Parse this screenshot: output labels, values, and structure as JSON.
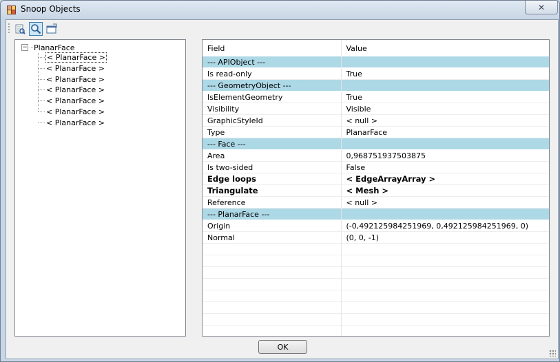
{
  "window": {
    "title": "Snoop Objects"
  },
  "toolbar": {
    "buttons": [
      {
        "icon": "object-snoop-icon",
        "active": false
      },
      {
        "icon": "zoom-search-icon",
        "active": true
      },
      {
        "icon": "copy-window-icon",
        "active": false
      }
    ]
  },
  "tree": {
    "root": "PlanarFace",
    "expander_glyph": "−",
    "children": [
      "< PlanarFace >",
      "< PlanarFace >",
      "< PlanarFace >",
      "< PlanarFace >",
      "< PlanarFace >",
      "< PlanarFace >",
      "< PlanarFace >"
    ]
  },
  "grid": {
    "headers": {
      "field": "Field",
      "value": "Value"
    },
    "rows": [
      {
        "field": "--- APIObject ---",
        "value": "",
        "kind": "section"
      },
      {
        "field": "Is read-only",
        "value": "True",
        "kind": "normal"
      },
      {
        "field": "--- GeometryObject ---",
        "value": "",
        "kind": "section"
      },
      {
        "field": "IsElementGeometry",
        "value": "True",
        "kind": "normal"
      },
      {
        "field": "Visibility",
        "value": "Visible",
        "kind": "normal"
      },
      {
        "field": "GraphicStyleId",
        "value": "< null >",
        "kind": "normal"
      },
      {
        "field": "Type",
        "value": "PlanarFace",
        "kind": "normal"
      },
      {
        "field": "--- Face ---",
        "value": "",
        "kind": "section"
      },
      {
        "field": "Area",
        "value": "0,968751937503875",
        "kind": "normal"
      },
      {
        "field": "Is two-sided",
        "value": "False",
        "kind": "normal"
      },
      {
        "field": "Edge loops",
        "value": "< EdgeArrayArray >",
        "kind": "strong"
      },
      {
        "field": "Triangulate",
        "value": "< Mesh >",
        "kind": "strong"
      },
      {
        "field": "Reference",
        "value": "< null >",
        "kind": "normal"
      },
      {
        "field": "--- PlanarFace ---",
        "value": "",
        "kind": "section"
      },
      {
        "field": "Origin",
        "value": "(-0,492125984251969, 0,492125984251969, 0)",
        "kind": "normal"
      },
      {
        "field": "Normal",
        "value": "(0, 0, -1)",
        "kind": "normal"
      }
    ],
    "empty_rows": 8,
    "colors": {
      "section": "#add8e6"
    }
  },
  "footer": {
    "ok_label": "OK"
  },
  "titlebar": {
    "close_glyph": "✕"
  }
}
